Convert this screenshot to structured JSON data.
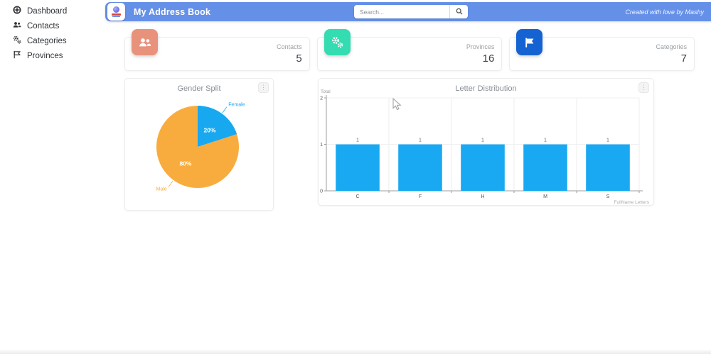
{
  "sidebar": {
    "items": [
      {
        "label": "Dashboard",
        "icon": "dashboard-icon"
      },
      {
        "label": "Contacts",
        "icon": "contacts-icon"
      },
      {
        "label": "Categories",
        "icon": "categories-icon"
      },
      {
        "label": "Provinces",
        "icon": "flag-icon"
      }
    ]
  },
  "header": {
    "title": "My Address Book",
    "search_placeholder": "Search...",
    "credit": "Created with love by Mashy",
    "accent_color": "#6590e8"
  },
  "stats": [
    {
      "label": "Contacts",
      "value": "5",
      "icon": "people-icon",
      "color": "#e8927c"
    },
    {
      "label": "Provinces",
      "value": "16",
      "icon": "gears-icon",
      "color": "#33dcb1"
    },
    {
      "label": "Categories",
      "value": "7",
      "icon": "flag-icon",
      "color": "#1563d2"
    }
  ],
  "ui": {
    "menu_icon": "⋮"
  },
  "chart_data": [
    {
      "type": "pie",
      "title": "Gender Split",
      "labels": [
        "Female",
        "Male"
      ],
      "values": [
        20,
        80
      ],
      "value_suffix": "%",
      "colors": [
        "#18a8f0",
        "#f9ac3e"
      ],
      "start_angle_deg": -90,
      "direction": "clockwise",
      "legend_position": "outside-labels"
    },
    {
      "type": "bar",
      "title": "Letter Distribution",
      "categories": [
        "C",
        "F",
        "H",
        "M",
        "S"
      ],
      "values": [
        1,
        1,
        1,
        1,
        1
      ],
      "value_labels": [
        "1",
        "1",
        "1",
        "1",
        "1"
      ],
      "ylabel": "Total",
      "xlabel": "FullName Letters",
      "ylim": [
        0,
        2
      ],
      "yticks": [
        0,
        1,
        2
      ],
      "grid": true,
      "bar_color": "#19a9f2"
    }
  ]
}
